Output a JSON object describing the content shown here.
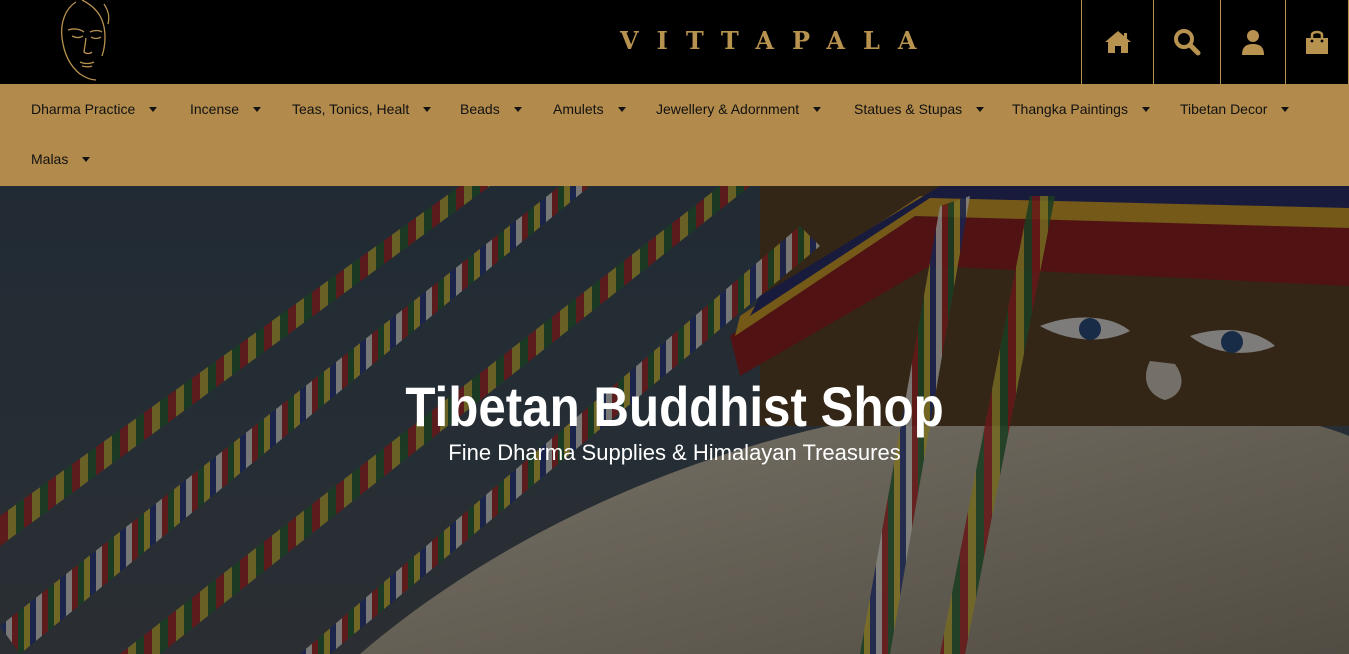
{
  "header": {
    "brand": "VITTAPALA",
    "icons": [
      "home-icon",
      "search-icon",
      "account-icon",
      "shopping-bag-icon"
    ],
    "accent_color": "#b8924f"
  },
  "nav": {
    "background": "#b28b4c",
    "items": [
      {
        "label": "Dharma Practice"
      },
      {
        "label": "Incense"
      },
      {
        "label": "Teas, Tonics, Healt"
      },
      {
        "label": "Beads"
      },
      {
        "label": "Amulets"
      },
      {
        "label": "Jewellery & Adornment"
      },
      {
        "label": "Statues & Stupas"
      },
      {
        "label": "Thangka Paintings"
      },
      {
        "label": "Tibetan Decor"
      },
      {
        "label": "Malas"
      }
    ]
  },
  "hero": {
    "title": "Tibetan Buddhist Shop",
    "subtitle": "Fine Dharma Supplies & Himalayan Treasures"
  }
}
